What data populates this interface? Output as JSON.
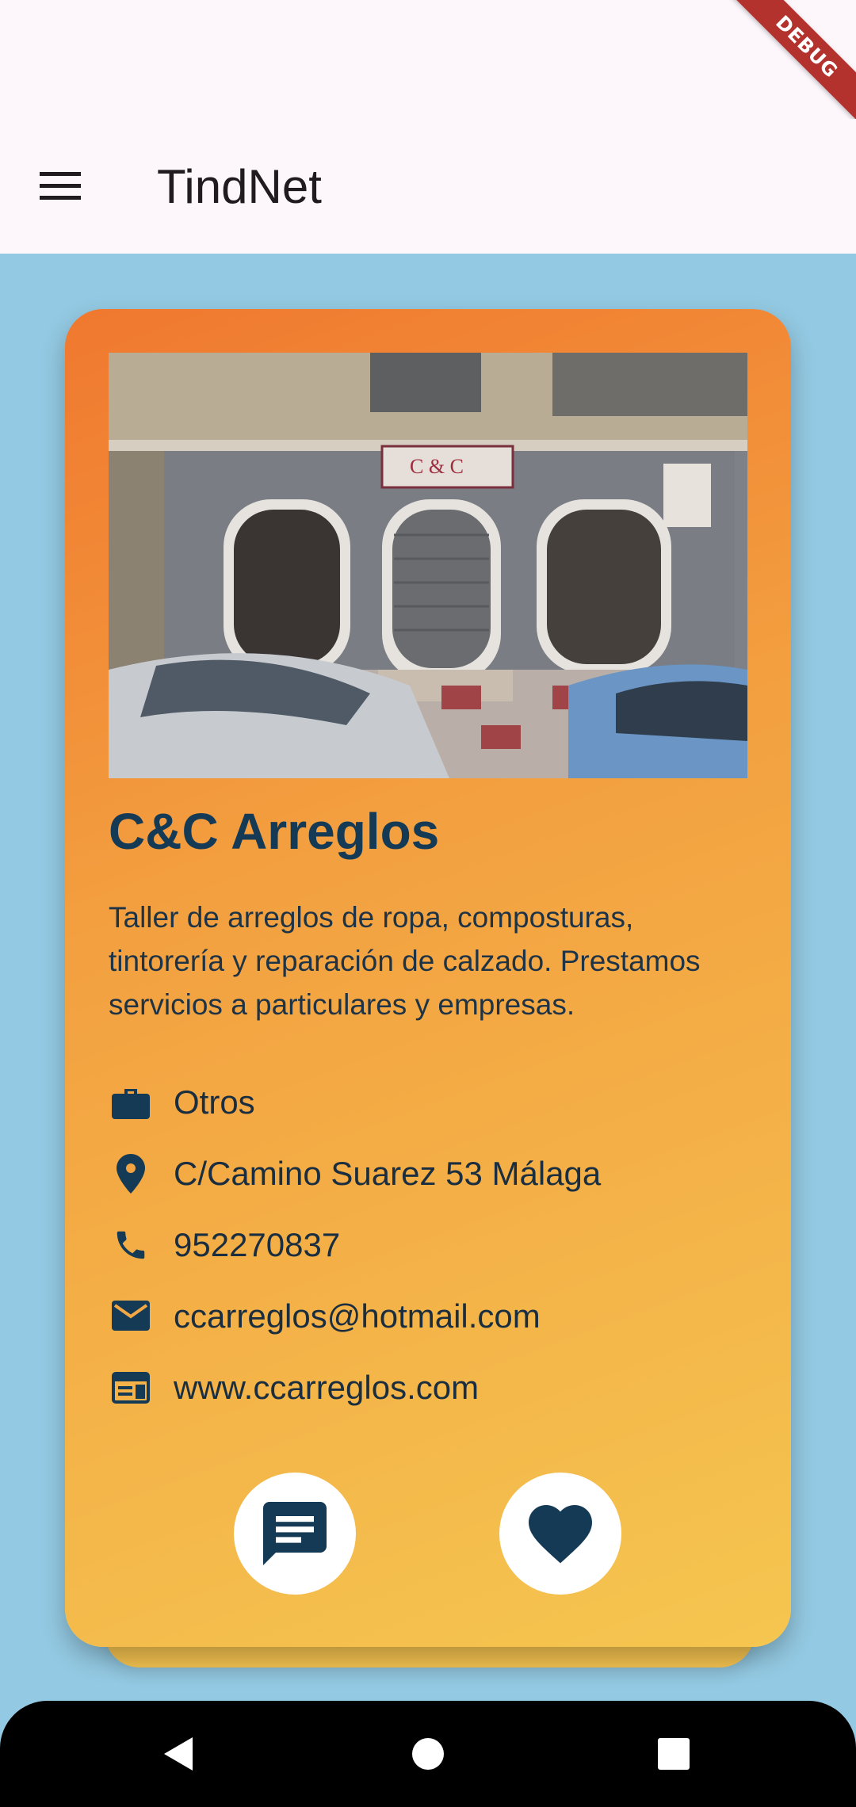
{
  "status_bar": {
    "debug_label": "DEBUG"
  },
  "app_bar": {
    "title": "TindNet",
    "menu_icon": "menu-icon"
  },
  "card": {
    "name": "C&C Arreglos",
    "description": "Taller de arreglos de ropa, composturas, tintorería y reparación de calzado. Prestamos servicios a particulares y empresas.",
    "photo": {
      "sign_text": "C & C"
    },
    "details": [
      {
        "icon": "briefcase-icon",
        "text": "Otros"
      },
      {
        "icon": "location-pin-icon",
        "text": "C/Camino Suarez 53 Málaga"
      },
      {
        "icon": "phone-icon",
        "text": "952270837"
      },
      {
        "icon": "email-icon",
        "text": "ccarreglos@hotmail.com"
      },
      {
        "icon": "web-icon",
        "text": "www.ccarreglos.com"
      }
    ],
    "actions": [
      {
        "icon": "chat-icon"
      },
      {
        "icon": "heart-icon"
      }
    ]
  },
  "navigation_bar": {
    "back_icon": "back-icon",
    "home_icon": "home-icon",
    "recents_icon": "recents-icon"
  },
  "colors": {
    "background": "#93C9E2",
    "app_bar": "#FDF7FB",
    "card_gradient_start": "#F0782F",
    "card_gradient_end": "#F5C650",
    "accent_dark": "#143A56",
    "debug_ribbon": "#B3322E"
  }
}
